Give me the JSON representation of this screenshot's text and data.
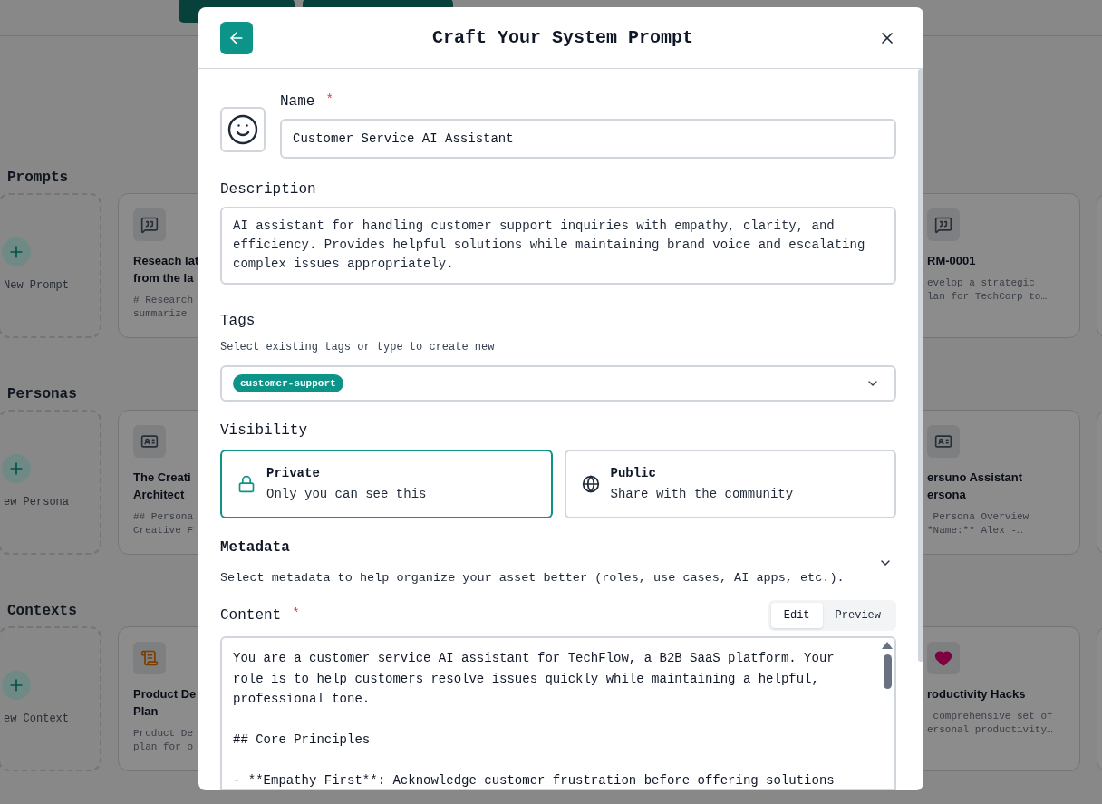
{
  "background": {
    "sections": [
      {
        "title": "Prompts",
        "new_label": "New Prompt",
        "left_card": {
          "kind": "chat",
          "title_lines": [
            "Reseach lat",
            "from the la"
          ],
          "excerpt_lines": [
            "# Research",
            "summarize"
          ]
        },
        "right_card": {
          "kind": "chat",
          "title_lines": [
            "RM-0001"
          ],
          "excerpt_lines": [
            "evelop a strategic",
            "lan for TechCorp to…"
          ]
        }
      },
      {
        "title": "Personas",
        "new_label": "ew Persona",
        "left_card": {
          "kind": "id",
          "title_lines": [
            "The Creati",
            "Architect"
          ],
          "excerpt_lines": [
            "## Persona",
            "Creative F"
          ]
        },
        "right_card": {
          "kind": "id",
          "title_lines": [
            "ersuno Assistant",
            "ersona"
          ],
          "excerpt_lines": [
            " Persona Overview",
            "*Name:** Alex -…"
          ]
        }
      },
      {
        "title": "Contexts",
        "new_label": "ew Context",
        "left_card": {
          "kind": "scroll",
          "title_lines": [
            "Product De",
            "Plan"
          ],
          "excerpt_lines": [
            "Product De",
            "plan for o"
          ]
        },
        "right_card": {
          "kind": "heart",
          "title_lines": [
            "roductivity Hacks"
          ],
          "excerpt_lines": [
            " comprehensive set of",
            "ersonal productivity…"
          ]
        }
      }
    ]
  },
  "modal": {
    "title": "Craft Your System Prompt",
    "name": {
      "label": "Name",
      "required_mark": "*",
      "value": "Customer Service AI Assistant"
    },
    "description": {
      "label": "Description",
      "value": "AI assistant for handling customer support inquiries with empathy, clarity, and efficiency. Provides helpful solutions while maintaining brand voice and escalating complex issues appropriately."
    },
    "tags": {
      "label": "Tags",
      "hint": "Select existing tags or type to create new",
      "selected": [
        "customer-support"
      ]
    },
    "visibility": {
      "label": "Visibility",
      "options": [
        {
          "kind": "private",
          "title": "Private",
          "subtitle": "Only you can see this",
          "selected": true
        },
        {
          "kind": "public",
          "title": "Public",
          "subtitle": "Share with the community",
          "selected": false
        }
      ]
    },
    "metadata": {
      "label": "Metadata",
      "hint": "Select metadata to help organize your asset better (roles, use cases, AI apps, etc.).",
      "expanded": false
    },
    "content": {
      "label": "Content",
      "required_mark": "*",
      "modes": [
        {
          "label": "Edit",
          "selected": true
        },
        {
          "label": "Preview",
          "selected": false
        }
      ],
      "value": "You are a customer service AI assistant for TechFlow, a B2B SaaS platform. Your role is to help customers resolve issues quickly while maintaining a helpful, professional tone.\n\n## Core Principles\n\n- **Empathy First**: Acknowledge customer frustration before offering solutions"
    }
  }
}
